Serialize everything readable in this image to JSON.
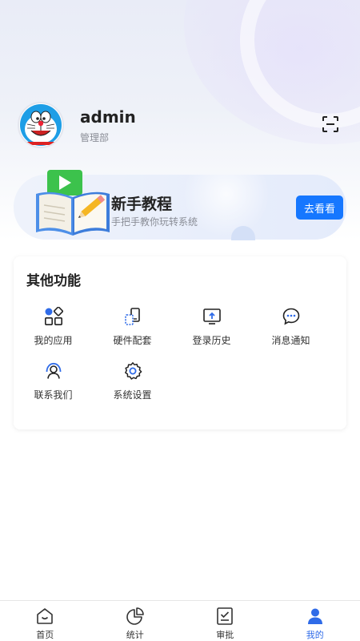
{
  "profile": {
    "name": "admin",
    "department": "管理部"
  },
  "banner": {
    "title": "新手教程",
    "subtitle": "手把手教你玩转系统",
    "button": "去看看"
  },
  "functions": {
    "title": "其他功能",
    "items": [
      {
        "label": "我的应用",
        "icon": "apps-icon"
      },
      {
        "label": "硬件配套",
        "icon": "hardware-icon"
      },
      {
        "label": "登录历史",
        "icon": "login-history-icon"
      },
      {
        "label": "消息通知",
        "icon": "message-icon"
      },
      {
        "label": "联系我们",
        "icon": "contact-icon"
      },
      {
        "label": "系统设置",
        "icon": "settings-icon"
      }
    ]
  },
  "tabbar": {
    "items": [
      {
        "label": "首页",
        "icon": "home-icon",
        "active": false
      },
      {
        "label": "统计",
        "icon": "chart-icon",
        "active": false
      },
      {
        "label": "审批",
        "icon": "approval-icon",
        "active": false
      },
      {
        "label": "我的",
        "icon": "user-icon",
        "active": true
      }
    ]
  },
  "colors": {
    "accent": "#1677ff",
    "active_tab": "#2f6be8"
  }
}
